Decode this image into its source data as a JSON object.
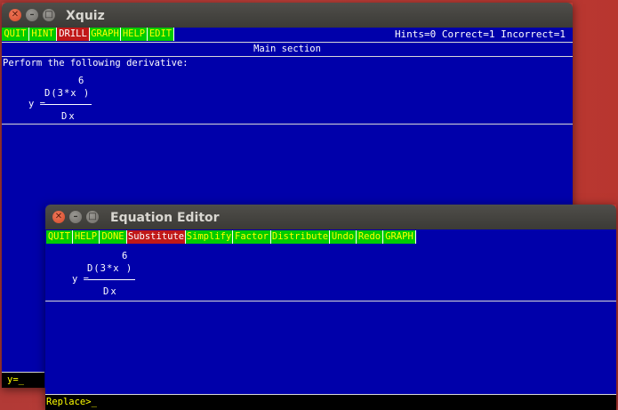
{
  "xquiz": {
    "title": "Xquiz",
    "menu": [
      "QUIT",
      "HINT",
      "DRILL",
      "GRAPH",
      "HELP",
      "EDIT"
    ],
    "selected_menu": "DRILL",
    "status": "Hints=0 Correct=1 Incorrect=1",
    "section": "Main section",
    "prompt_text": "Perform the following derivative:",
    "equation": {
      "lhs": "y =",
      "exponent": "6",
      "numerator": "D(3*x )",
      "denominator": "Dx"
    },
    "input": "y=_"
  },
  "editor": {
    "title": "Equation Editor",
    "menu": [
      "QUIT",
      "HELP",
      "DONE",
      "Substitute",
      "Simplify",
      "Factor",
      "Distribute",
      "Undo",
      "Redo",
      "GRAPH"
    ],
    "selected_menu": "Substitute",
    "equation": {
      "lhs": "y =",
      "exponent": "6",
      "numerator": "D(3*x )",
      "denominator": "Dx"
    },
    "command": "Replace>_"
  },
  "colors": {
    "background": "#0000aa",
    "menu_item": "#00cc00",
    "menu_text": "#ffff00",
    "menu_selected": "#c01818",
    "desktop": "#b8362f"
  }
}
